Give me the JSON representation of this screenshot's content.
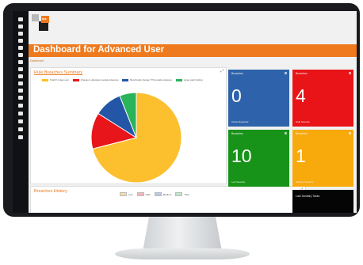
{
  "logo": {
    "text": "sis"
  },
  "page": {
    "title": "Dashboard for Advanced User",
    "breadcrumb": "Dashboard"
  },
  "rule_breaches": {
    "title": "Rule Breaches Summary",
    "chart_data": {
      "type": "pie",
      "categories": [
        "Total P-2 days over",
        "Change in allocation outside tolerance",
        "Benchmark change YTD outside tolerance",
        "Large cash holding"
      ],
      "values": [
        71,
        13,
        10,
        6
      ],
      "colors": [
        "#fcbf2e",
        "#e8151b",
        "#2356a6",
        "#2bb35a"
      ]
    }
  },
  "breaches_history": {
    "title": "Breaches History",
    "legend": [
      {
        "label": "Low",
        "color": "#f6dcaa"
      },
      {
        "label": "High",
        "color": "#f4b6b6"
      },
      {
        "label": "Medium",
        "color": "#b9c9e6"
      },
      {
        "label": "Total",
        "color": "#bfe3cb"
      }
    ]
  },
  "tiles": [
    {
      "head": "Breaches",
      "value": "0",
      "sub": "Action Required",
      "color": "#2e63ab"
    },
    {
      "head": "Breaches",
      "value": "4",
      "sub": "High Severity",
      "color": "#e81417"
    },
    {
      "head": "Breaches",
      "value": "10",
      "sub": "Low Severity",
      "color": "#189319"
    },
    {
      "head": "Breaches",
      "value": "1",
      "sub": "Medium Severity",
      "color": "#f8a90c"
    },
    {
      "head": "Last Sanitary Tasks",
      "value": "",
      "sub": "",
      "color": "#050505"
    }
  ]
}
